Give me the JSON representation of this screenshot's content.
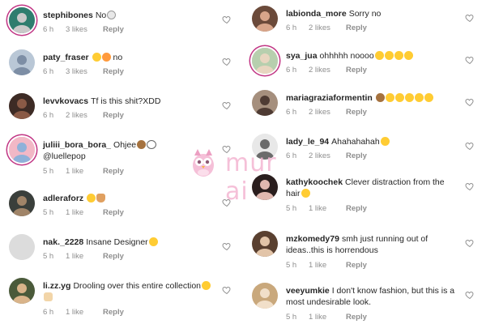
{
  "watermark": {
    "brand": "mur ai"
  },
  "left_comments": [
    {
      "username": "stephibones",
      "text": "No",
      "emojis": [
        "skull-emoji"
      ],
      "time": "6 h",
      "likes": "3 likes",
      "reply": "Reply",
      "ring": true
    },
    {
      "username": "paty_fraser",
      "text": "",
      "text_after": "no",
      "emojis": [
        "surprised-face-emoji",
        "pouting-face-emoji"
      ],
      "time": "6 h",
      "likes": "3 likes",
      "reply": "Reply",
      "ring": false
    },
    {
      "username": "levvkovacs",
      "text": "Tf is this shit?XDD",
      "emojis": [],
      "time": "6 h",
      "likes": "2 likes",
      "reply": "Reply",
      "ring": false
    },
    {
      "username": "juliii_bora_bora_",
      "text": "Ohjee",
      "mention": "@luellepop",
      "emojis": [
        "see-no-evil-monkey-emoji",
        "eyes-emoji"
      ],
      "time": "5 h",
      "likes": "1 like",
      "reply": "Reply",
      "ring": true
    },
    {
      "username": "adleraforz",
      "text": "",
      "emojis": [
        "surprised-face-emoji",
        "person-emoji"
      ],
      "time": "5 h",
      "likes": "1 like",
      "reply": "Reply",
      "ring": false
    },
    {
      "username": "nak._2228",
      "text": "Insane Designer",
      "emojis": [
        "rolling-eyes-emoji"
      ],
      "time": "5 h",
      "likes": "1 like",
      "reply": "Reply",
      "ring": false
    },
    {
      "username": "li.zz.yg",
      "text": "Drooling over this entire collection",
      "emojis": [
        "drooling-face-emoji",
        "hand-emoji"
      ],
      "time": "6 h",
      "likes": "1 like",
      "reply": "Reply",
      "ring": false
    }
  ],
  "right_comments": [
    {
      "username": "labionda_more",
      "text": "Sorry no",
      "emojis": [],
      "time": "6 h",
      "likes": "2 likes",
      "reply": "Reply",
      "ring": false
    },
    {
      "username": "sya_jua",
      "text": "ohhhhh noooo",
      "emojis": [
        "laughing-emoji",
        "laughing-emoji",
        "laughing-emoji",
        "laughing-emoji"
      ],
      "time": "6 h",
      "likes": "2 likes",
      "reply": "Reply",
      "ring": true
    },
    {
      "username": "mariagraziaformentin",
      "text": "",
      "emojis": [
        "see-no-evil-monkey-emoji",
        "rofl-emoji",
        "rofl-emoji",
        "rofl-emoji",
        "rofl-emoji",
        "rofl-emoji"
      ],
      "time": "6 h",
      "likes": "2 likes",
      "reply": "Reply",
      "ring": false
    },
    {
      "username": "lady_le_94",
      "text": "Ahahahahah",
      "emojis": [
        "laughing-emoji"
      ],
      "time": "6 h",
      "likes": "2 likes",
      "reply": "Reply",
      "ring": false
    },
    {
      "username": "kathykoochek",
      "text": "Clever distraction from the hair",
      "emojis": [
        "rolling-eyes-emoji"
      ],
      "time": "5 h",
      "likes": "1 like",
      "reply": "Reply",
      "ring": false
    },
    {
      "username": "mzkomedy79",
      "text": "smh just running out of ideas..this is horrendous",
      "emojis": [],
      "time": "5 h",
      "likes": "1 like",
      "reply": "Reply",
      "ring": false
    },
    {
      "username": "veeyumkie",
      "text": "I don't know fashion, but this is a most undesirable look.",
      "emojis": [],
      "time": "5 h",
      "likes": "1 like",
      "reply": "Reply",
      "ring": false
    }
  ],
  "colors": {
    "text": "#262626",
    "meta": "#8e8e8e",
    "mention": "#00376b",
    "story_ring": "#c13584",
    "watermark": "#f4b6d2"
  }
}
